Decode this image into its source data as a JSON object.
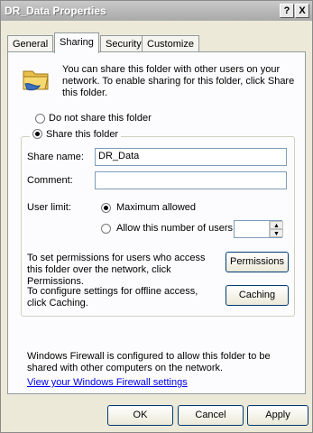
{
  "window": {
    "title": "DR_Data Properties",
    "help_label": "?",
    "close_label": "X"
  },
  "tabs": [
    {
      "label": "General"
    },
    {
      "label": "Sharing"
    },
    {
      "label": "Security"
    },
    {
      "label": "Customize"
    }
  ],
  "sharing": {
    "info_text": "You can share this folder with other users on your network.  To enable sharing for this folder, click Share this folder.",
    "do_not_share_label": "Do not share this folder",
    "share_label": "Share this folder",
    "share_selected": true,
    "share_name_label": "Share name:",
    "share_name_value": "DR_Data",
    "comment_label": "Comment:",
    "comment_value": "",
    "user_limit_label": "User limit:",
    "maximum_allowed_label": "Maximum allowed",
    "allow_number_label": "Allow this number of users:",
    "permissions_text": "To set permissions for users who access this folder over the network, click Permissions.",
    "permissions_button": "Permissions",
    "caching_text": "To configure settings for offline access, click Caching.",
    "caching_button": "Caching",
    "firewall_text": "Windows Firewall is configured to allow this folder to be shared with other computers on the network.",
    "firewall_link": "View your Windows Firewall settings"
  },
  "footer": {
    "ok_label": "OK",
    "cancel_label": "Cancel",
    "apply_label": "Apply"
  }
}
